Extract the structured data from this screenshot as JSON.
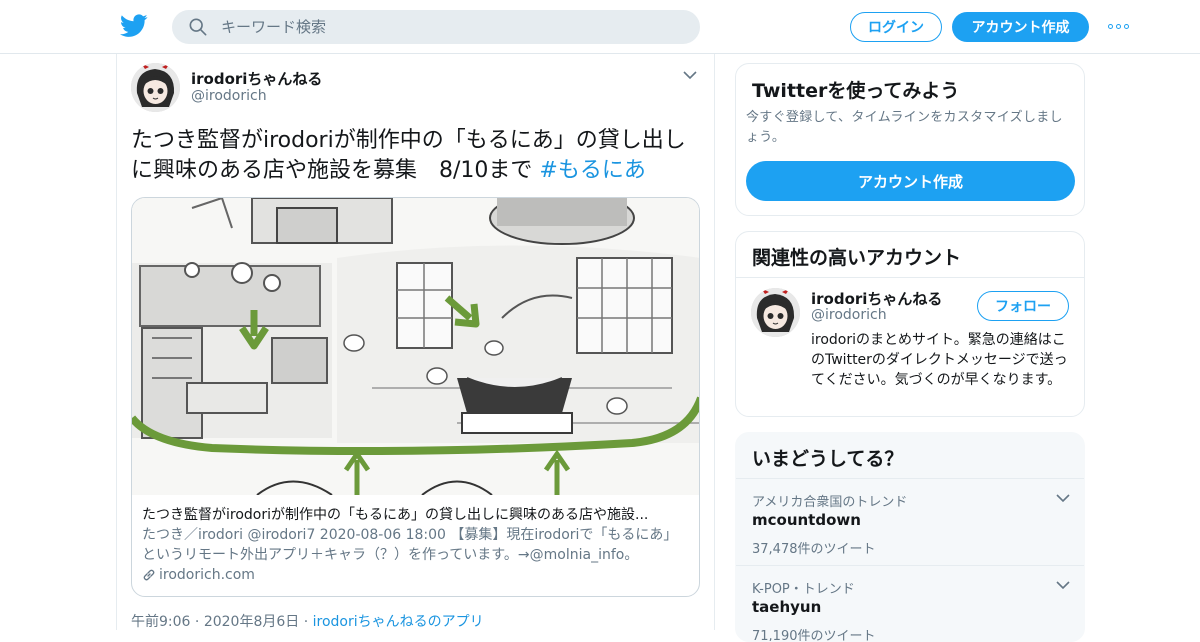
{
  "header": {
    "search_placeholder": "キーワード検索",
    "login_label": "ログイン",
    "signup_label": "アカウント作成"
  },
  "tweet": {
    "display_name": "irodoriちゃんねる",
    "screen_name": "@irodorich",
    "text": "たつき監督がirodoriが制作中の「もるにあ」の貸し出しに興味のある店や施設を募集　8/10まで ",
    "hashtag": "#もるにあ",
    "card": {
      "title": "たつき監督がirodoriが制作中の「もるにあ」の貸し出しに興味のある店や施設...",
      "description": "たつき／irodori @irodori7 2020-08-06 18:00 【募集】現在irodoriで「もるにあ」というリモート外出アプリ＋キャラ（？）を作っています。→@molnia_info。",
      "link": "irodorich.com"
    },
    "time": "午前9:06",
    "date": "2020年8月6日",
    "source": "irodoriちゃんねるのアプリ"
  },
  "signup_module": {
    "title": "Twitterを使ってみよう",
    "subtitle": "今すぐ登録して、タイムラインをカスタマイズしましょう。",
    "button_label": "アカウント作成"
  },
  "related_module": {
    "title": "関連性の高いアカウント",
    "account": {
      "name": "irodoriちゃんねる",
      "handle": "@irodorich",
      "follow_label": "フォロー",
      "bio": "irodoriのまとめサイト。緊急の連絡はこのTwitterのダイレクトメッセージで送ってください。気づくのが早くなります。"
    }
  },
  "trends_module": {
    "title": "いまどうしてる？",
    "trends": [
      {
        "context": "アメリカ合衆国のトレンド",
        "name": "mcountdown",
        "count": "37,478件のツイート"
      },
      {
        "context": "K-POP・トレンド",
        "name": "taehyun",
        "count": "71,190件のツイート"
      }
    ]
  },
  "colors": {
    "brand": "#1da1f2",
    "link": "#1b95e0",
    "secondary_text": "#657786",
    "border": "#e6ecf0"
  },
  "icons": [
    "twitter-bird-icon",
    "search-icon",
    "more-icon",
    "chevron-down-icon",
    "link-icon"
  ]
}
